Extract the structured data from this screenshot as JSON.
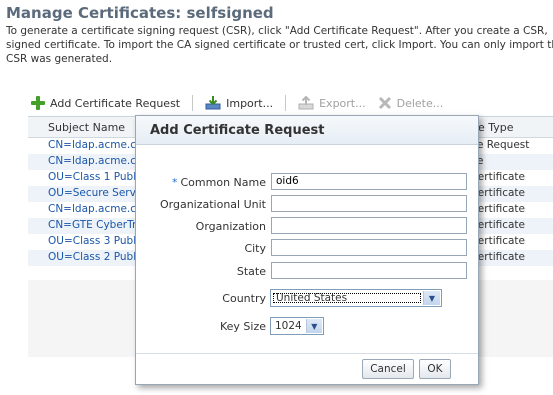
{
  "page": {
    "title": "Manage Certificates: selfsigned",
    "description_lines": [
      "To generate a certificate signing request (CSR), click \"Add Certificate Request\". After you create a CSR, ",
      "signed certificate. To import the CA signed certificate or trusted cert, click Import. You can only import th",
      "CSR was generated."
    ]
  },
  "toolbar": {
    "add_label": "Add Certificate Request",
    "import_label": "Import...",
    "export_label": "Export...",
    "delete_label": "Delete..."
  },
  "table": {
    "columns": [
      "Subject Name",
      "ficate Type"
    ],
    "rows": [
      {
        "subject": "CN=ldap.acme.c",
        "type": "ficate Request"
      },
      {
        "subject": "CN=ldap.acme.c",
        "type": "ficate"
      },
      {
        "subject": "OU=Class 1 Publi",
        "type": "ed Certificate"
      },
      {
        "subject": "OU=Secure Serv",
        "type": "ed Certificate"
      },
      {
        "subject": "CN=ldap.acme.c",
        "type": "ed Certificate"
      },
      {
        "subject": "CN=GTE CyberTr",
        "type": "ed Certificate"
      },
      {
        "subject": "OU=Class 3 Publi",
        "type": "ed Certificate"
      },
      {
        "subject": "OU=Class 2 Publi",
        "type": "ed Certificate"
      }
    ]
  },
  "dialog": {
    "title": "Add Certificate Request",
    "required_marker": "*",
    "fields": {
      "common_name": {
        "label": "Common Name",
        "value": "oid6"
      },
      "org_unit": {
        "label": "Organizational Unit",
        "value": ""
      },
      "organization": {
        "label": "Organization",
        "value": ""
      },
      "city": {
        "label": "City",
        "value": ""
      },
      "state": {
        "label": "State",
        "value": ""
      },
      "country": {
        "label": "Country",
        "value": "United States"
      },
      "key_size": {
        "label": "Key Size",
        "value": "1024"
      }
    },
    "cancel_label": "Cancel",
    "ok_label": "OK"
  }
}
